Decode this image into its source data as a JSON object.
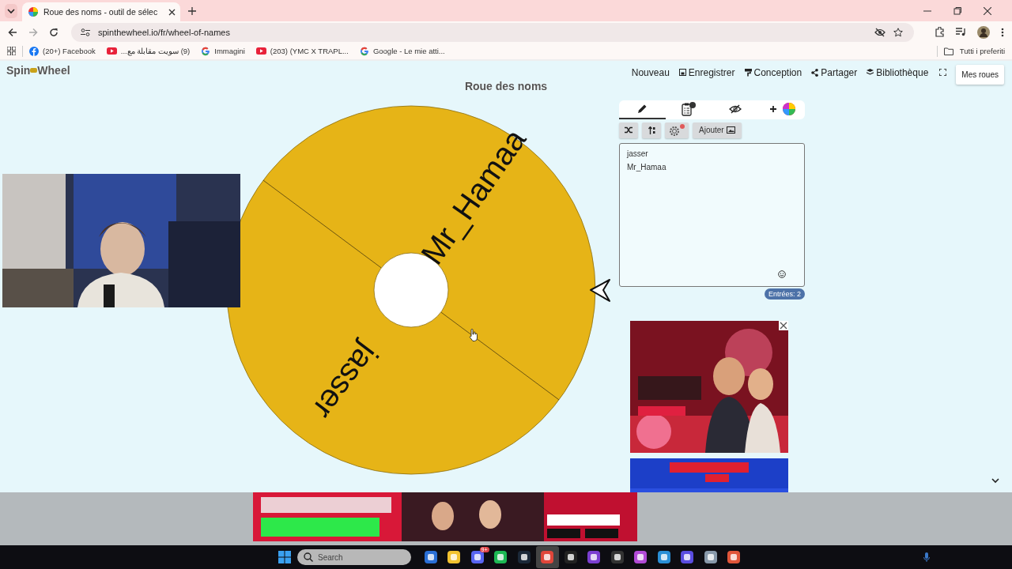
{
  "browser": {
    "tabs": [
      {
        "title": "Roue des noms - outil de sélec",
        "selected": true
      }
    ],
    "url": "spinthewheel.io/fr/wheel-of-names",
    "bookmarks": [
      {
        "kind": "facebook",
        "label": "(20+) Facebook"
      },
      {
        "kind": "youtube",
        "label": "(9) سويت مقابلة مع..."
      },
      {
        "kind": "google",
        "label": "Immagini"
      },
      {
        "kind": "youtube",
        "label": "(203) (YMC X TRAPL..."
      },
      {
        "kind": "google",
        "label": "Google - Le mie atti..."
      }
    ],
    "all_bookmarks": "Tutti i preferiti"
  },
  "site": {
    "logo": [
      "Spin",
      "Wheel"
    ],
    "nav": [
      {
        "kind": "plain",
        "label": "Nouveau"
      },
      {
        "kind": "save",
        "label": "Enregistrer"
      },
      {
        "kind": "paint",
        "label": "Conception"
      },
      {
        "kind": "share",
        "label": "Partager"
      },
      {
        "kind": "stack",
        "label": "Bibliothèque"
      }
    ],
    "my_wheels": "Mes roues"
  },
  "wheel": {
    "title": "Roue des noms",
    "segments": [
      {
        "label": "Mr_Hamaa"
      },
      {
        "label": "jasser"
      }
    ]
  },
  "editor": {
    "tabs": [
      {
        "kind": "edit",
        "selected": true
      },
      {
        "kind": "results",
        "selected": false
      },
      {
        "kind": "hidden",
        "selected": false
      },
      {
        "kind": "add",
        "selected": false
      }
    ],
    "add_button": "Ajouter",
    "entries": [
      "jasser",
      "Mr_Hamaa"
    ],
    "count": "Entrées: 2"
  },
  "taskbar": {
    "search_placeholder": "Search",
    "chat_badge": "9+"
  }
}
